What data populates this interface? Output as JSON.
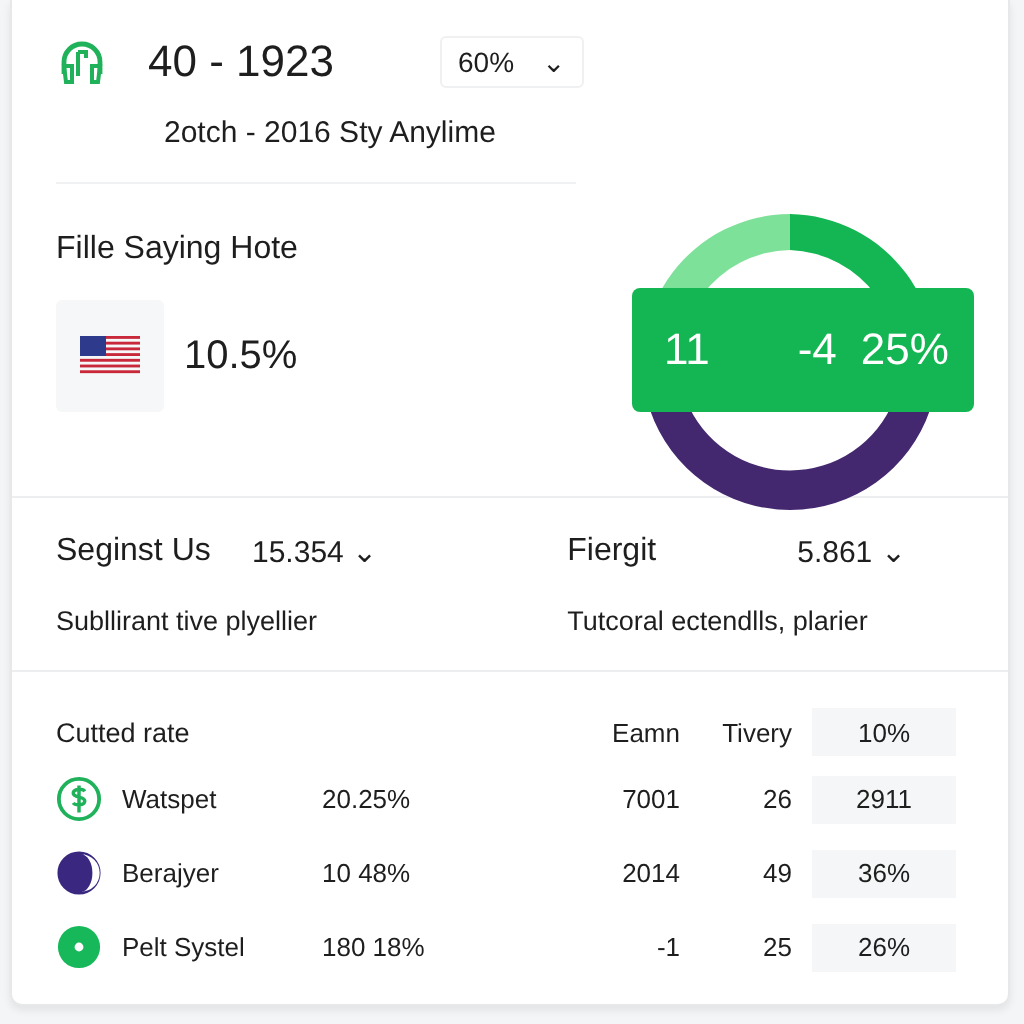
{
  "header": {
    "title": "40 - 1923",
    "dropdown": {
      "value": "60%",
      "caret": "⌄"
    },
    "subtitle": "2otch - 2016 Sty Anylime"
  },
  "highlight": {
    "title": "Fille Saying Hote",
    "value": "10.5%"
  },
  "donut_label": [
    "11",
    "-4",
    "25%"
  ],
  "stats": [
    {
      "label": "Seginst Us",
      "value": "15.354",
      "caret": "⌄",
      "note": "Subllirant tive plyellier"
    },
    {
      "label": "Fiergit",
      "value": "5.861",
      "caret": "⌄",
      "note": "Tutcoral ectendlls, plarier"
    }
  ],
  "table": {
    "columns": [
      "Cutted rate",
      "Eamn",
      "Tivery",
      "10%"
    ],
    "rows": [
      {
        "kind": "dollar",
        "name": "Watspet",
        "rate": "20.25%",
        "earn": "7001",
        "tivery": "26",
        "last": "2911"
      },
      {
        "kind": "moon",
        "name": "Berajyer",
        "rate": "10 48%",
        "earn": "2014",
        "tivery": "49",
        "last": "36%"
      },
      {
        "kind": "dot",
        "name": "Pelt Systel",
        "rate": "180 18%",
        "earn": "-1",
        "tivery": "25",
        "last": "26%"
      }
    ]
  }
}
